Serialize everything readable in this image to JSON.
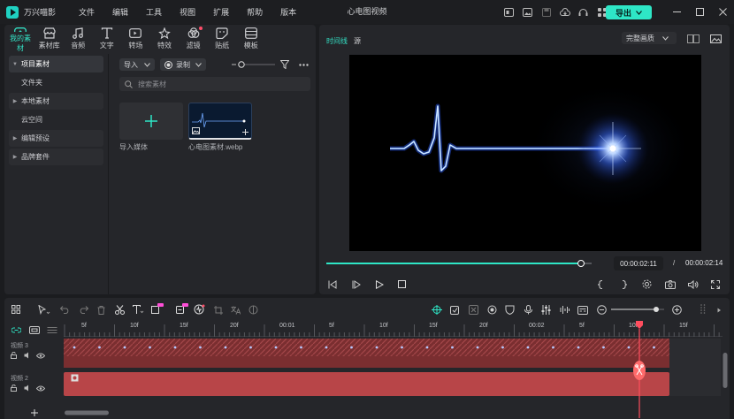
{
  "app": {
    "name": "万兴喵影",
    "window_title": "心电图视频"
  },
  "menu": [
    "文件",
    "编辑",
    "工具",
    "视图",
    "扩展",
    "帮助",
    "版本"
  ],
  "title_icons": [
    "layout-icon",
    "picture-icon",
    "save-icon",
    "cloud-icon",
    "headset-icon",
    "grid-icon",
    "cart-icon",
    "gift-icon"
  ],
  "export_button": "导出",
  "media_tabs": [
    {
      "label": "我的素材",
      "icon": "my-media-icon"
    },
    {
      "label": "素材库",
      "icon": "store-icon"
    },
    {
      "label": "音频",
      "icon": "music-icon"
    },
    {
      "label": "文字",
      "icon": "text-icon"
    },
    {
      "label": "转场",
      "icon": "transition-icon"
    },
    {
      "label": "特效",
      "icon": "effects-icon"
    },
    {
      "label": "滤镜",
      "icon": "filter-icon"
    },
    {
      "label": "贴纸",
      "icon": "sticker-icon"
    },
    {
      "label": "模板",
      "icon": "template-icon"
    }
  ],
  "sidebar": [
    {
      "label": "项目素材",
      "type": "expanded"
    },
    {
      "label": "文件夹",
      "type": "child"
    },
    {
      "label": "本地素材",
      "type": "collapsed"
    },
    {
      "label": "云空间",
      "type": "child"
    },
    {
      "label": "编辑预设",
      "type": "collapsed"
    },
    {
      "label": "品牌套件",
      "type": "collapsed"
    }
  ],
  "media_toolbar": {
    "import": "导入",
    "record": "录制"
  },
  "search": {
    "placeholder": "搜索素材"
  },
  "media_items": [
    {
      "label": "导入媒体"
    },
    {
      "label": "心电图素材.webp"
    }
  ],
  "preview": {
    "tab_timeline": "时间线",
    "tab_source": "源",
    "quality": "完整画质",
    "current_time": "00:00:02:11",
    "separator": "/",
    "total_time": "00:00:02:14",
    "progress": 0.96
  },
  "ruler_labels": [
    "5f",
    "10f",
    "15f",
    "20f",
    "00:01",
    "5f",
    "10f",
    "15f",
    "20f",
    "00:02",
    "5f",
    "10f",
    "15f"
  ],
  "tracks": [
    {
      "name": "视频 3"
    },
    {
      "name": "视频 2"
    }
  ],
  "colors": {
    "accent": "#2ee6c6",
    "clip": "#b84548",
    "playhead": "#ff4d5e"
  }
}
